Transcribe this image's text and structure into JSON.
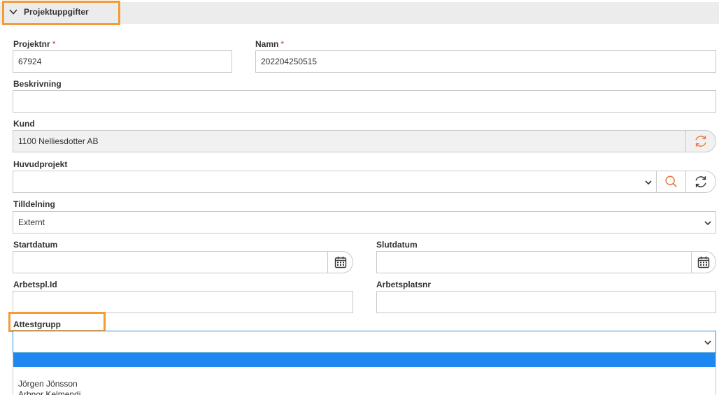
{
  "section": {
    "title": "Projektuppgifter"
  },
  "fields": {
    "projektnr": {
      "label": "Projektnr",
      "required": "*",
      "value": "67924"
    },
    "namn": {
      "label": "Namn",
      "required": "*",
      "value": "202204250515"
    },
    "beskrivning": {
      "label": "Beskrivning",
      "value": ""
    },
    "kund": {
      "label": "Kund",
      "value": "1100 Nelliesdotter AB"
    },
    "huvudprojekt": {
      "label": "Huvudprojekt",
      "value": ""
    },
    "tilldelning": {
      "label": "Tilldelning",
      "value": "Externt"
    },
    "startdatum": {
      "label": "Startdatum",
      "value": ""
    },
    "slutdatum": {
      "label": "Slutdatum",
      "value": ""
    },
    "arbetspl_id": {
      "label": "Arbetspl.Id",
      "value": ""
    },
    "arbetsplatsnr": {
      "label": "Arbetsplatsnr",
      "value": ""
    },
    "attestgrupp": {
      "label": "Attestgrupp",
      "value": "",
      "options": [
        "",
        "Jörgen Jönsson",
        "Arbnor Kelmendi"
      ]
    }
  },
  "colors": {
    "accent_orange": "#f39c35",
    "icon_orange": "#e8773c",
    "selected_blue": "#1e88f0",
    "required_red": "#c0392b"
  },
  "icons": {
    "collapse": "chevron-down-icon",
    "kund_refresh": "refresh-icon",
    "huvudprojekt_search": "search-icon",
    "huvudprojekt_refresh": "refresh-icon",
    "calendar": "calendar-icon"
  }
}
